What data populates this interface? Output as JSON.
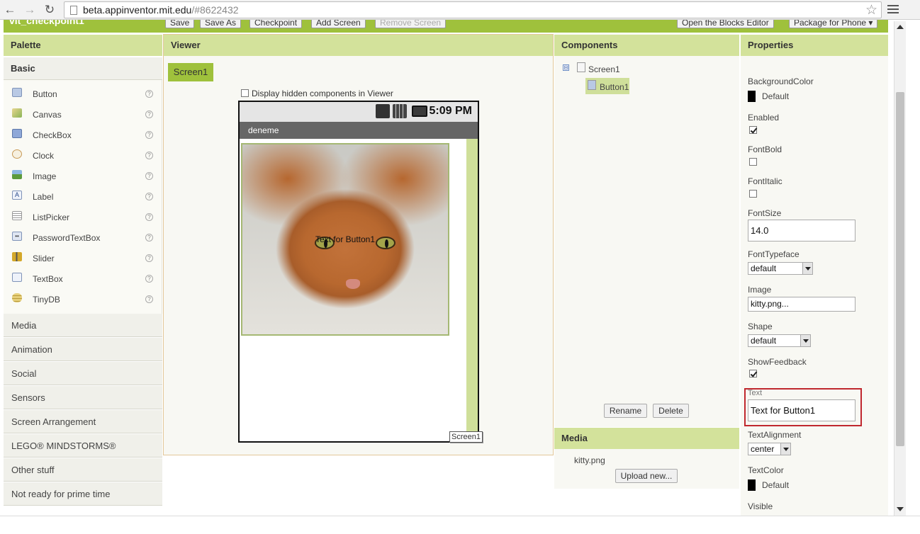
{
  "browser": {
    "url_host": "beta.appinventor.mit.edu",
    "url_path": "/#8622432"
  },
  "toolbar": {
    "project_title": "vit_checkpoint1",
    "save": "Save",
    "save_as": "Save As",
    "checkpoint": "Checkpoint",
    "add_screen": "Add Screen",
    "remove_screen": "Remove Screen",
    "open_blocks": "Open the Blocks Editor",
    "package": "Package for Phone ▾"
  },
  "palette": {
    "title": "Palette",
    "basic": "Basic",
    "items": [
      {
        "label": "Button",
        "help": "?"
      },
      {
        "label": "Canvas",
        "help": "?"
      },
      {
        "label": "CheckBox",
        "help": "?"
      },
      {
        "label": "Clock",
        "help": "?"
      },
      {
        "label": "Image",
        "help": "?"
      },
      {
        "label": "Label",
        "help": "?"
      },
      {
        "label": "ListPicker",
        "help": "?"
      },
      {
        "label": "PasswordTextBox",
        "help": "?"
      },
      {
        "label": "Slider",
        "help": "?"
      },
      {
        "label": "TextBox",
        "help": "?"
      },
      {
        "label": "TinyDB",
        "help": "?"
      }
    ],
    "categories": [
      "Media",
      "Animation",
      "Social",
      "Sensors",
      "Screen Arrangement",
      "LEGO® MINDSTORMS®",
      "Other stuff",
      "Not ready for prime time"
    ]
  },
  "viewer": {
    "title": "Viewer",
    "screen_tab": "Screen1",
    "hidden_checkbox_label": "Display hidden components in Viewer",
    "status_time": "5:09 PM",
    "app_title": "deneme",
    "button_text": "Text for Button1",
    "screen_label": "Screen1"
  },
  "components": {
    "title": "Components",
    "toggle": "⊟",
    "screen": "Screen1",
    "button": "Button1",
    "rename": "Rename",
    "delete": "Delete"
  },
  "media": {
    "title": "Media",
    "file": "kitty.png",
    "upload": "Upload new..."
  },
  "properties": {
    "title": "Properties",
    "background_color_label": "BackgroundColor",
    "background_color_value": "Default",
    "enabled_label": "Enabled",
    "enabled_checked": true,
    "fontbold_label": "FontBold",
    "fontbold_checked": false,
    "fontitalic_label": "FontItalic",
    "fontitalic_checked": false,
    "fontsize_label": "FontSize",
    "fontsize_value": "14.0",
    "fonttypeface_label": "FontTypeface",
    "fonttypeface_value": "default",
    "image_label": "Image",
    "image_value": "kitty.png...",
    "shape_label": "Shape",
    "shape_value": "default",
    "showfeedback_label": "ShowFeedback",
    "showfeedback_checked": true,
    "text_label": "Text",
    "text_value": "Text for Button1",
    "textalignment_label": "TextAlignment",
    "textalignment_value": "center",
    "textcolor_label": "TextColor",
    "textcolor_value": "Default",
    "visible_label": "Visible"
  },
  "colors": {
    "accent_green": "#9fc13c",
    "header_green": "#d3e29b",
    "highlight_red": "#c0282e"
  }
}
